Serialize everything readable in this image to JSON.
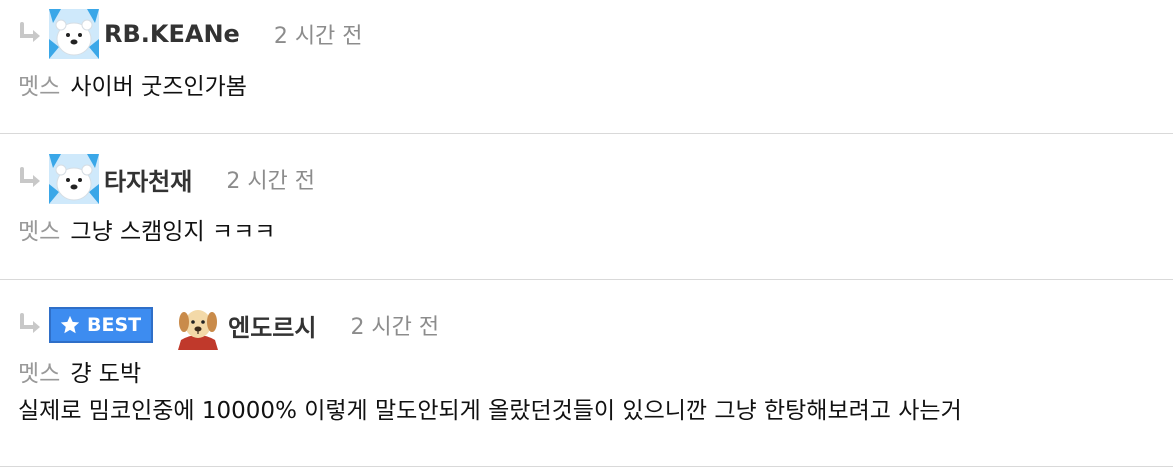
{
  "comments": [
    {
      "username": "RB.KEANe",
      "time": "2 시간 전",
      "category": "멧스",
      "text": "사이버 굿즈인가봄",
      "avatar_icon": "polar-bear-icon"
    },
    {
      "username": "타자천재",
      "time": "2 시간 전",
      "category": "멧스",
      "text": "그냥 스캠잉지 ㅋㅋㅋ",
      "avatar_icon": "polar-bear-icon"
    },
    {
      "badge": "BEST",
      "username": "엔도르시",
      "time": "2 시간 전",
      "category": "멧스",
      "text": "걍 도박",
      "text_line2": "실제로 밈코인중에 10000% 이렇게 말도안되게 올랐던것들이 있으니깐 그냥 한탕해보려고 사는거",
      "avatar_icon": "puppy-icon"
    }
  ],
  "colors": {
    "badge_bg": "#3d8cf0",
    "category": "#999999",
    "time": "#8c8c8c",
    "arrow": "#c8c8c8"
  }
}
